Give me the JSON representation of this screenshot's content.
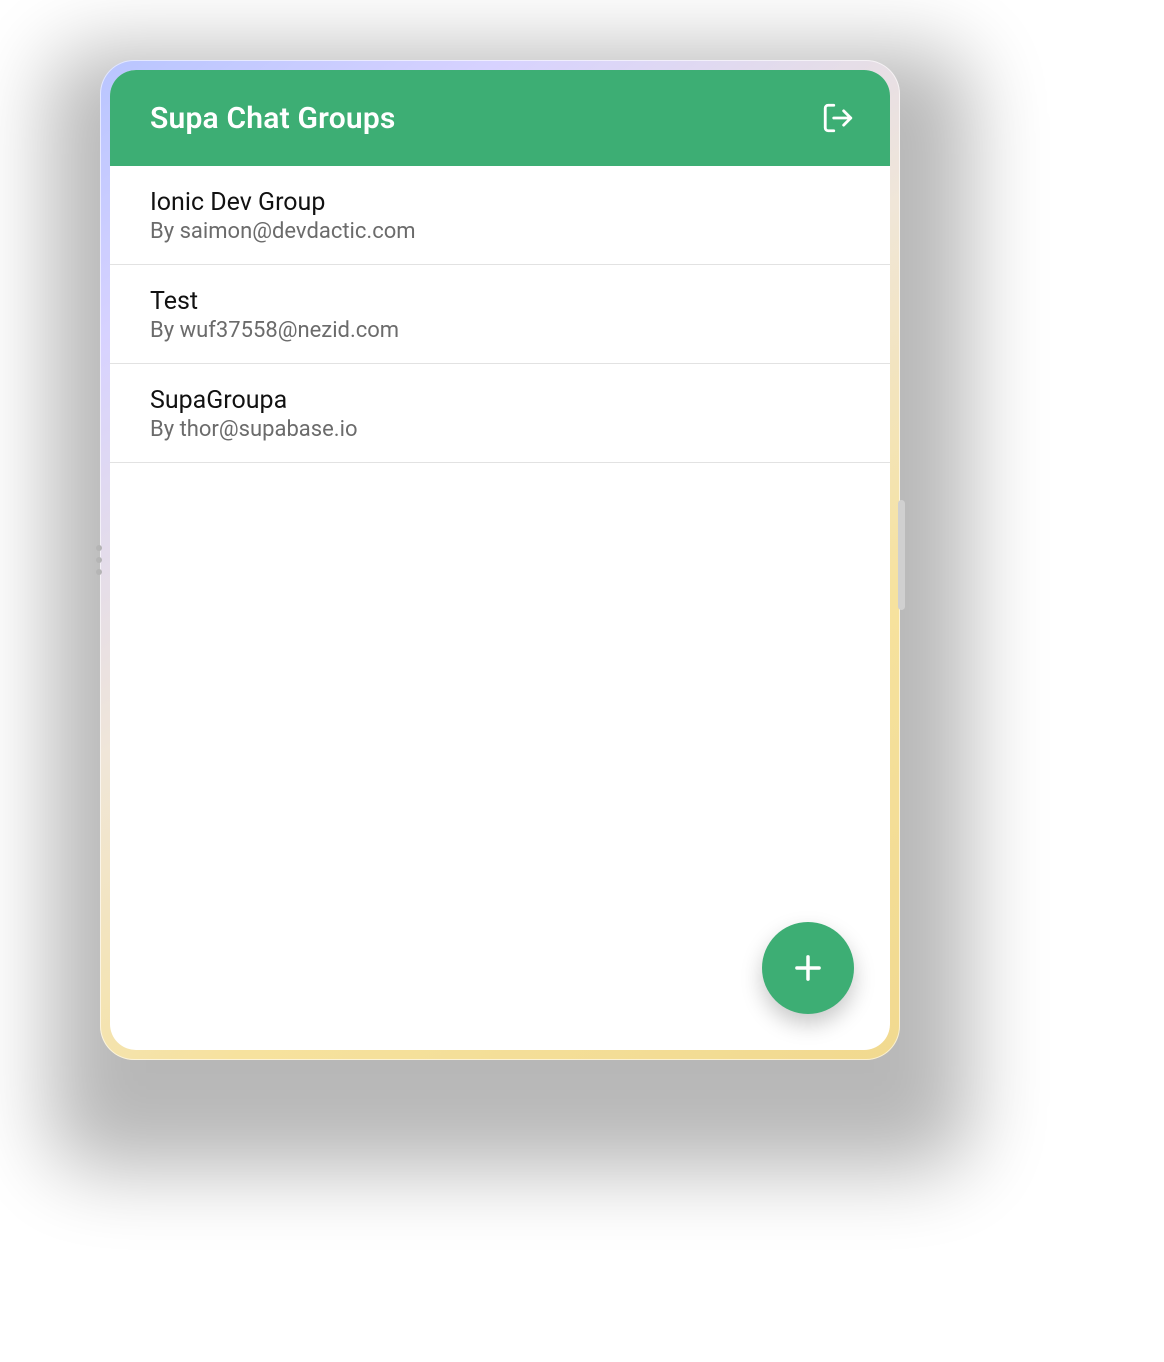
{
  "header": {
    "title": "Supa Chat Groups",
    "logout_icon": "log-out"
  },
  "groups": [
    {
      "title": "Ionic Dev Group",
      "byline": "By saimon@devdactic.com"
    },
    {
      "title": "Test",
      "byline": "By wuf37558@nezid.com"
    },
    {
      "title": "SupaGroupa",
      "byline": "By thor@supabase.io"
    }
  ],
  "fab": {
    "icon": "add"
  },
  "colors": {
    "primary": "#3DAE74"
  }
}
